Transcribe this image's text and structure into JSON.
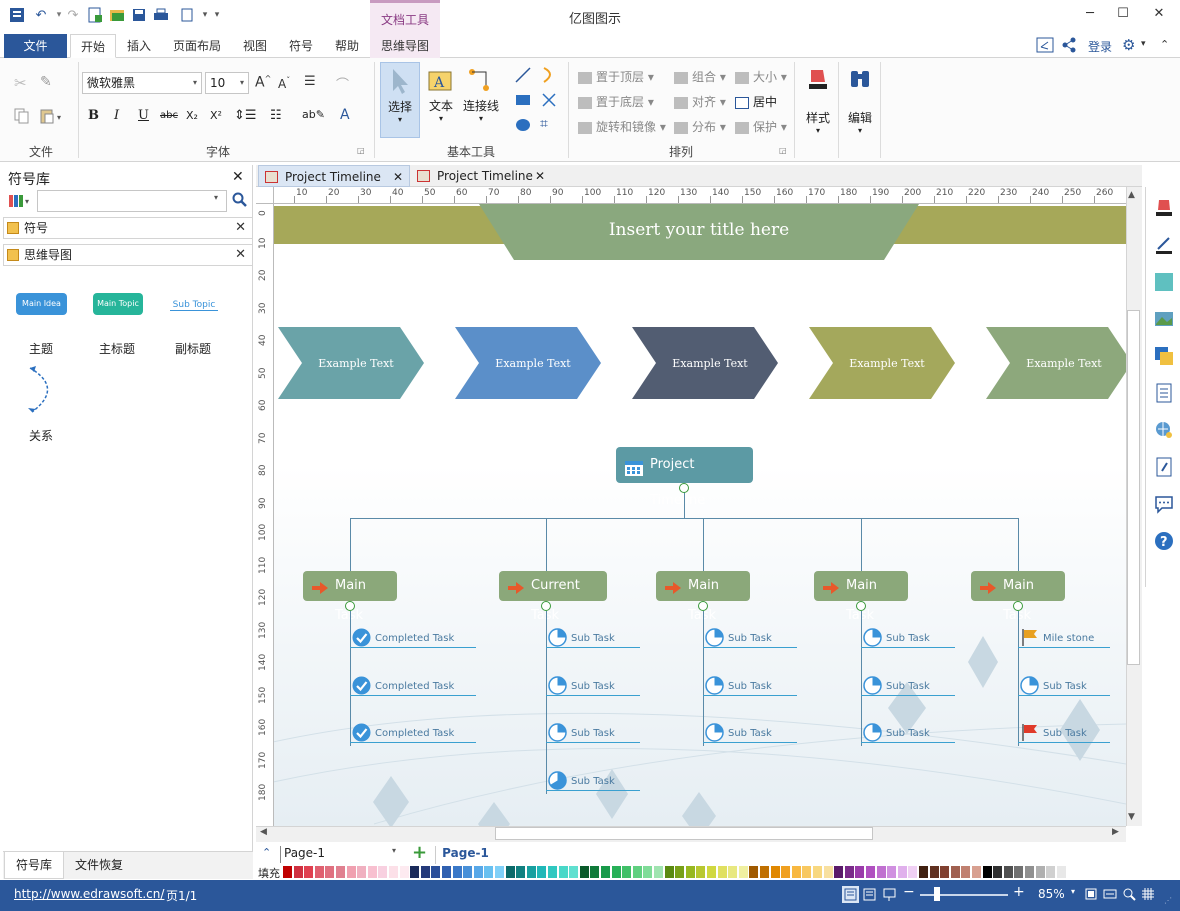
{
  "app": {
    "title": "亿图图示",
    "context_tab": "文档工具"
  },
  "menu": {
    "file": "文件",
    "tabs": [
      "开始",
      "插入",
      "页面布局",
      "视图",
      "符号",
      "帮助",
      "思维导图"
    ],
    "login": "登录"
  },
  "ribbon": {
    "groups": {
      "file": "文件",
      "font": "字体",
      "basic_tools": "基本工具",
      "arrange": "排列"
    },
    "font_name": "微软雅黑",
    "font_size": "10",
    "basic": {
      "select": "选择",
      "text": "文本",
      "connector": "连接线"
    },
    "arrange": {
      "bring_front": "置于顶层",
      "send_back": "置于底层",
      "rotate": "旋转和镜像",
      "group": "组合",
      "align": "对齐",
      "distribute": "分布",
      "size": "大小",
      "center": "居中",
      "protect": "保护"
    },
    "style": "样式",
    "edit": "编辑"
  },
  "left_panel": {
    "title": "符号库",
    "search_placeholder": "",
    "libraries": [
      "符号",
      "思维导图"
    ],
    "symbols": {
      "main_idea_btn": "Main Idea",
      "main_topic_btn": "Main Topic",
      "sub_topic_btn": "Sub Topic",
      "main_idea": "主题",
      "main_topic": "主标题",
      "sub_topic": "副标题",
      "relation": "关系"
    },
    "bottom_tabs": [
      "符号库",
      "文件恢复"
    ]
  },
  "doc_tabs": [
    "Project Timeline",
    "Project Timeline"
  ],
  "ruler": {
    "h_ticks": [
      "10",
      "20",
      "30",
      "40",
      "50",
      "60",
      "70",
      "80",
      "90",
      "100",
      "110",
      "120",
      "130",
      "140",
      "150",
      "160",
      "170",
      "180",
      "190",
      "200",
      "210",
      "220",
      "230",
      "240",
      "250",
      "260",
      "270"
    ],
    "v_ticks": [
      "0",
      "10",
      "20",
      "30",
      "40",
      "50",
      "60",
      "70",
      "80",
      "90",
      "100",
      "110",
      "120",
      "130",
      "140",
      "150",
      "160",
      "170",
      "180"
    ]
  },
  "canvas": {
    "title": "Insert your title here",
    "chevrons": [
      "Example Text",
      "Example Text",
      "Example Text",
      "Example Text",
      "Example Text"
    ],
    "chevron_colors": [
      "#6aa3a8",
      "#5b8fc9",
      "#525d72",
      "#a4a85c",
      "#8da87c"
    ],
    "root": "Project Timeline",
    "tasks": [
      {
        "label": "Main Task",
        "subs": [
          "Completed Task",
          "Completed Task",
          "Completed Task"
        ],
        "icon": "check-icon"
      },
      {
        "label": "Current Task",
        "subs": [
          "Sub Task",
          "Sub Task",
          "Sub Task",
          "Sub Task"
        ],
        "icon": "pie-icon"
      },
      {
        "label": "Main Task",
        "subs": [
          "Sub Task",
          "Sub Task",
          "Sub Task"
        ],
        "icon": "pie-icon"
      },
      {
        "label": "Main Task",
        "subs": [
          "Sub Task",
          "Sub Task",
          "Sub Task"
        ],
        "icon": "pie-icon"
      },
      {
        "label": "Main Task",
        "subs": [
          "Mile stone",
          "Sub Task",
          "Sub Task"
        ],
        "icon": "mixed"
      }
    ]
  },
  "pagebar": {
    "page_select": "Page-1",
    "page_tab": "Page-1",
    "fill_label": "填充"
  },
  "status": {
    "url": "http://www.edrawsoft.cn/",
    "page": "页1/1",
    "zoom": "85%"
  }
}
